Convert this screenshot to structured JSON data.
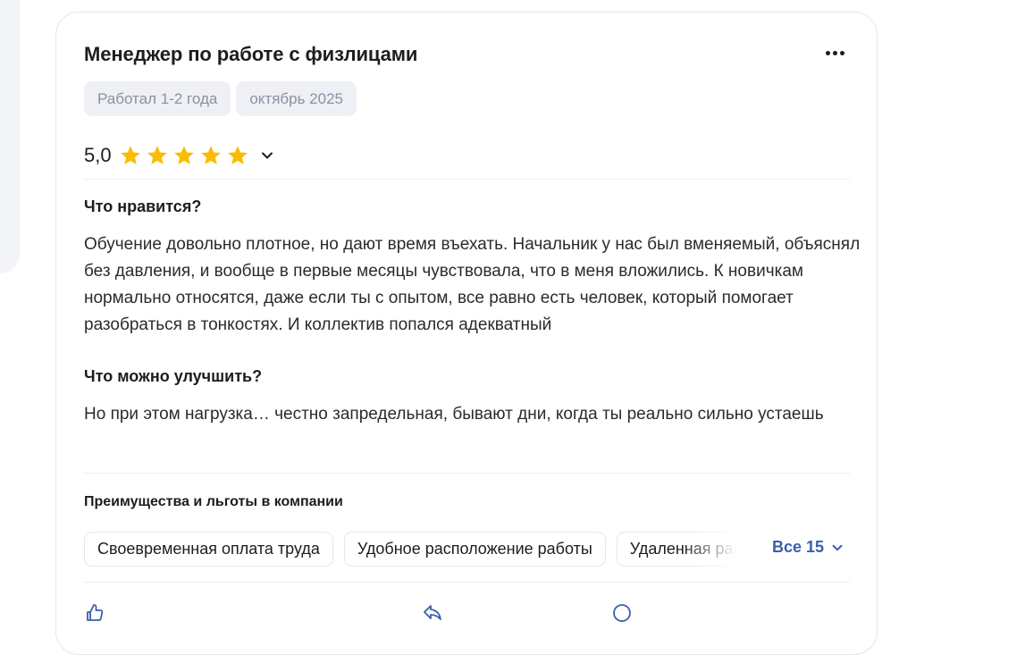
{
  "review": {
    "title": "Менеджер по работе с физлицами",
    "tags": [
      "Работал 1-2 года",
      "октябрь 2025"
    ],
    "rating": "5,0",
    "stars": 5,
    "likes_heading": "Что нравится?",
    "likes_text": "Обучение довольно плотное, но дают время въехать. Начальник у нас был вменяемый, объяснял без давления, и вообще в первые месяцы чувствовала, что в меня вложились. К новичкам нормально относятся, даже если ты с опытом, все равно есть человек, который помогает разобраться в тонкостях. И коллектив попался адекватный",
    "improve_heading": "Что можно улучшить?",
    "improve_text": "Но при этом нагрузка… честно запредельная, бывают дни, когда ты реально сильно устаешь",
    "benefits_heading": "Преимущества и льготы в компании",
    "benefits": [
      "Своевременная оплата труда",
      "Удобное расположение работы",
      "Удаленная работа"
    ],
    "benefits_all": "Все 15"
  },
  "colors": {
    "star": "#fbbc05",
    "link": "#3a5fa8",
    "tag_bg": "#eef0f5"
  },
  "icons": [
    "more-icon",
    "star-icon",
    "chevron-down-icon",
    "like-icon",
    "reply-icon",
    "comment-icon"
  ]
}
